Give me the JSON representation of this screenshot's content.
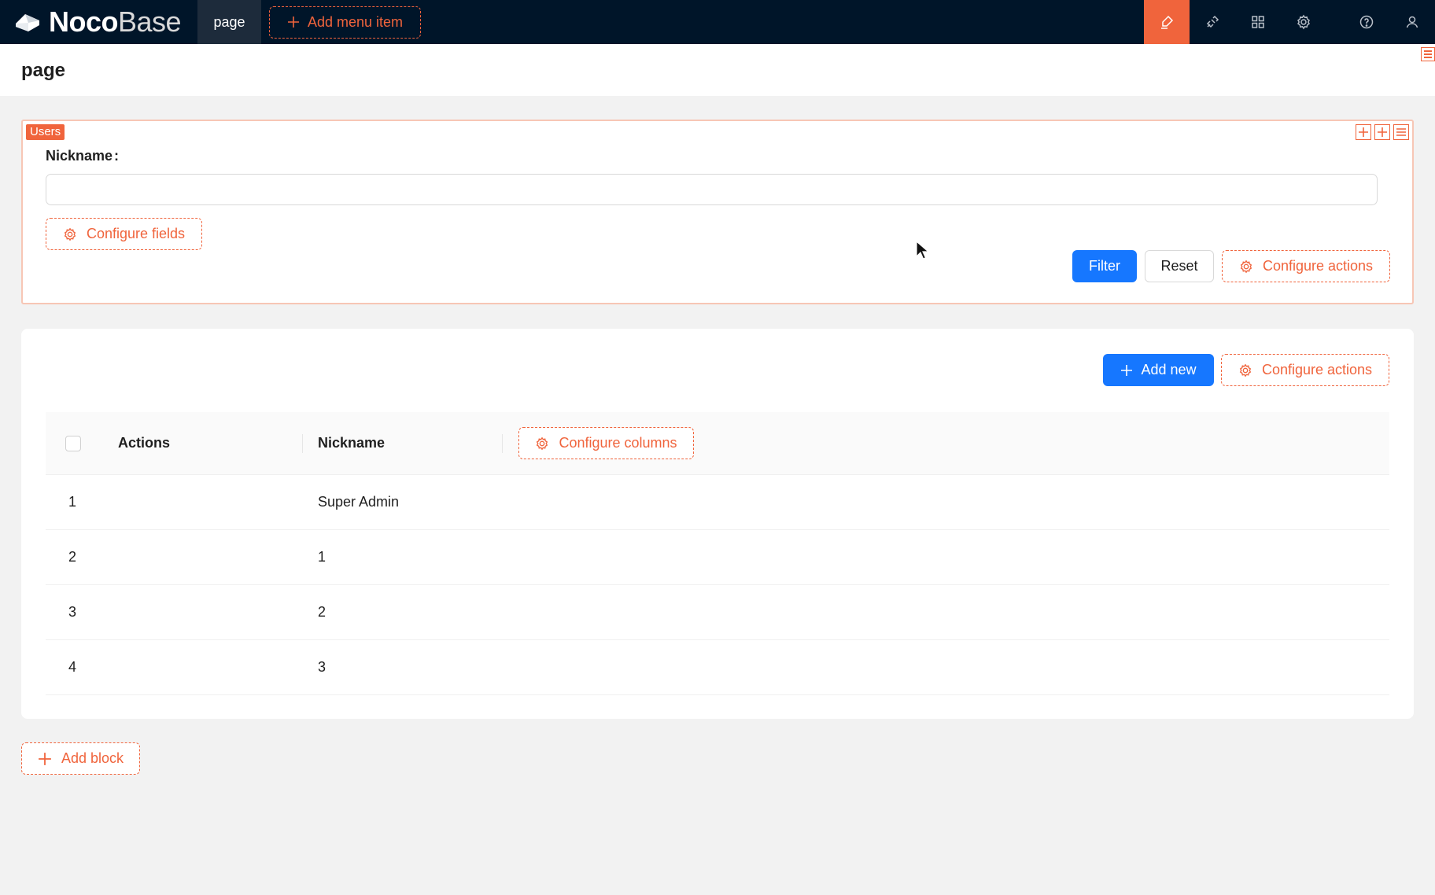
{
  "header": {
    "logo_noco": "Noco",
    "logo_base": "Base",
    "nav_tab": "page",
    "add_menu_item": "Add menu item",
    "icons": [
      "ui-editor-icon",
      "plugin-icon",
      "apps-icon",
      "settings-icon",
      "help-icon",
      "user-icon"
    ],
    "accent_color": "#f0643c",
    "bg_color": "#001529"
  },
  "page": {
    "title": "page"
  },
  "filter_block": {
    "tag": "Users",
    "field_label": "Nickname",
    "field_colon": ":",
    "field_value": "",
    "configure_fields": "Configure fields",
    "filter": "Filter",
    "reset": "Reset",
    "configure_actions": "Configure actions"
  },
  "table_block": {
    "add_new": "Add new",
    "configure_actions": "Configure actions",
    "columns": [
      "Actions",
      "Nickname"
    ],
    "configure_columns": "Configure columns",
    "rows": [
      {
        "index": "1",
        "nickname": "Super Admin"
      },
      {
        "index": "2",
        "nickname": "1"
      },
      {
        "index": "3",
        "nickname": "2"
      },
      {
        "index": "4",
        "nickname": "3"
      }
    ]
  },
  "add_block": "Add block",
  "primary_color": "#1677ff"
}
